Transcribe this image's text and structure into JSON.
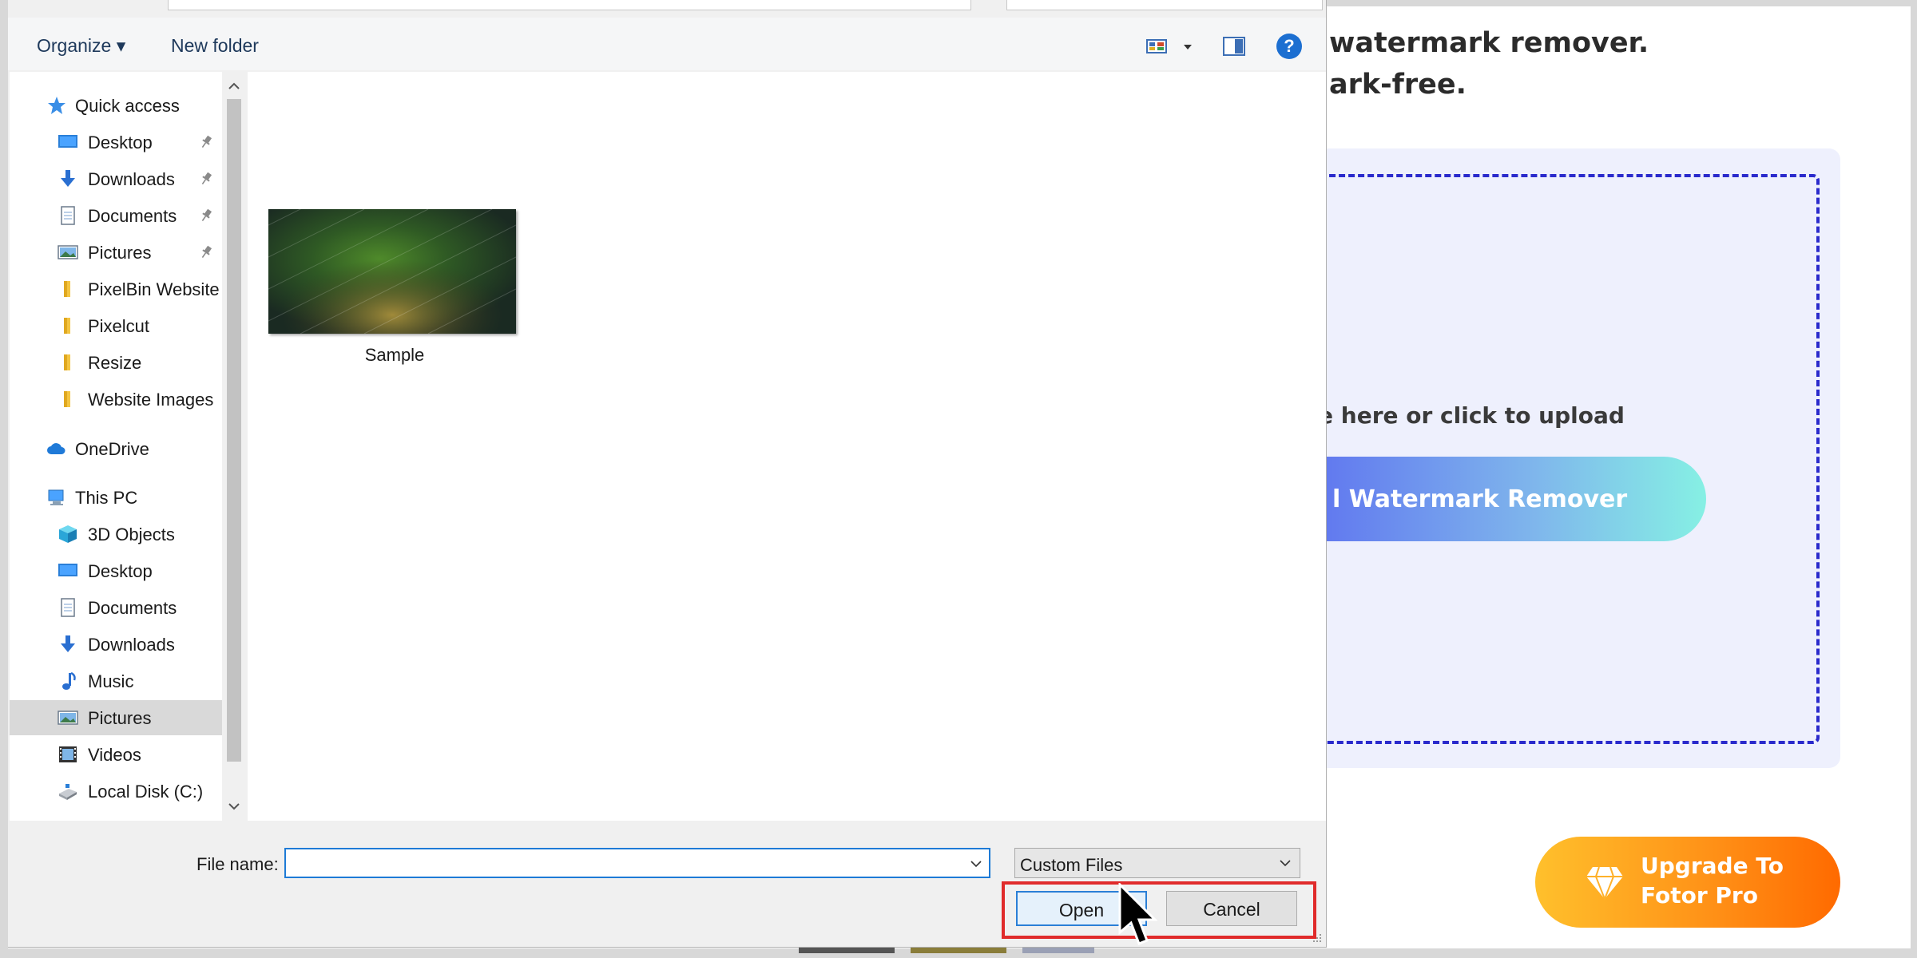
{
  "background_page": {
    "heading_line1": "watermark remover.",
    "heading_line2": "ark-free.",
    "upload_hint": "ge here or click to upload",
    "upload_button": "l Watermark Remover",
    "upgrade_line1": "Upgrade To",
    "upgrade_line2": "Fotor Pro",
    "colors": {
      "panel": "#eef0fd",
      "dash": "#2a2acc",
      "upgrade_start": "#ffc02c",
      "upgrade_end": "#ff6a00"
    }
  },
  "dialog": {
    "toolbar": {
      "organize": "Organize ▾",
      "new_folder": "New folder",
      "help": "?"
    },
    "nav": [
      {
        "label": "Quick access",
        "icon": "star-icon",
        "level": 0
      },
      {
        "label": "Desktop",
        "icon": "desktop-icon",
        "level": 1,
        "pinned": true
      },
      {
        "label": "Downloads",
        "icon": "download-icon",
        "level": 1,
        "pinned": true
      },
      {
        "label": "Documents",
        "icon": "document-icon",
        "level": 1,
        "pinned": true
      },
      {
        "label": "Pictures",
        "icon": "pictures-icon",
        "level": 1,
        "pinned": true
      },
      {
        "label": "PixelBin Website",
        "icon": "folder-icon",
        "level": 1
      },
      {
        "label": "Pixelcut",
        "icon": "folder-icon",
        "level": 1
      },
      {
        "label": "Resize",
        "icon": "folder-icon",
        "level": 1
      },
      {
        "label": "Website Images",
        "icon": "folder-icon",
        "level": 1
      },
      {
        "label": "OneDrive",
        "icon": "cloud-icon",
        "level": 0
      },
      {
        "label": "This PC",
        "icon": "computer-icon",
        "level": 0
      },
      {
        "label": "3D Objects",
        "icon": "cube-icon",
        "level": 1
      },
      {
        "label": "Desktop",
        "icon": "desktop-icon",
        "level": 1
      },
      {
        "label": "Documents",
        "icon": "document-icon",
        "level": 1
      },
      {
        "label": "Downloads",
        "icon": "download-icon",
        "level": 1
      },
      {
        "label": "Music",
        "icon": "music-icon",
        "level": 1
      },
      {
        "label": "Pictures",
        "icon": "pictures-icon",
        "level": 1,
        "selected": true
      },
      {
        "label": "Videos",
        "icon": "video-icon",
        "level": 1
      },
      {
        "label": "Local Disk (C:)",
        "icon": "disk-icon",
        "level": 1
      }
    ],
    "files": [
      {
        "name": "Sample"
      }
    ],
    "file_name_label": "File name:",
    "file_name_value": "",
    "filter_value": "Custom Files",
    "open_button": "Open",
    "cancel_button": "Cancel",
    "highlight_color": "#e02b2b"
  }
}
